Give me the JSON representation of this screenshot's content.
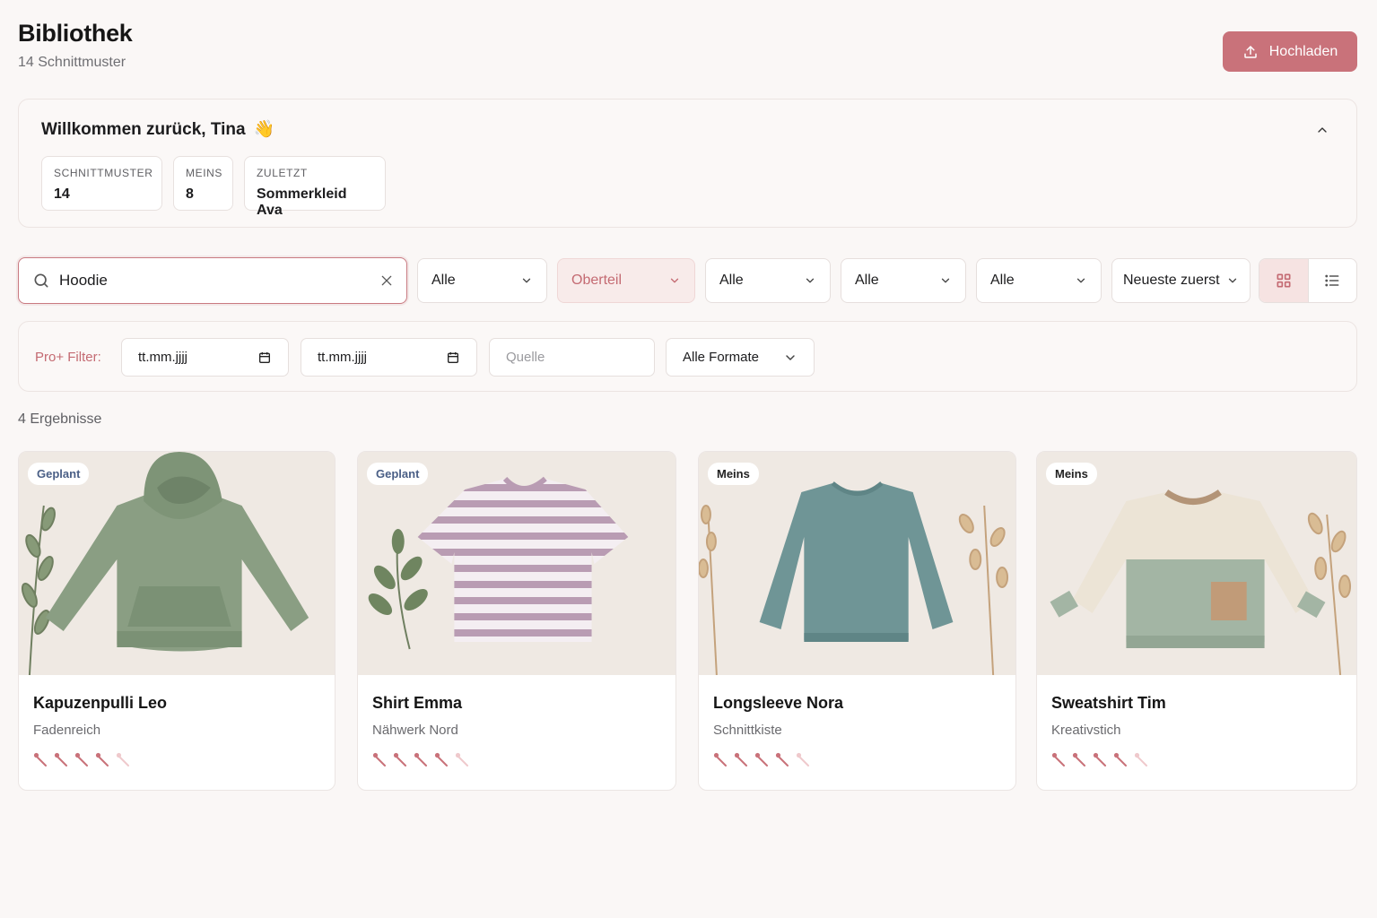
{
  "header": {
    "title": "Bibliothek",
    "subtitle": "14 Schnittmuster",
    "upload_label": "Hochladen"
  },
  "welcome": {
    "title": "Willkommen zurück, Tina",
    "emoji": "👋",
    "stats": [
      {
        "label": "Schnittmuster",
        "value": "14"
      },
      {
        "label": "Meins",
        "value": "8"
      },
      {
        "label": "Zuletzt",
        "value": "Sommerkleid Ava"
      }
    ]
  },
  "filters": {
    "search_value": "Hoodie",
    "selects": [
      "Alle",
      "Oberteil",
      "Alle",
      "Alle",
      "Alle",
      "Neueste zuerst"
    ],
    "active_select_index": 1
  },
  "pro_filter": {
    "label": "Pro+ Filter:",
    "date_from": "tt.mm.jjjj",
    "date_to": "tt.mm.jjjj",
    "source_placeholder": "Quelle",
    "format": "Alle Formate"
  },
  "results_label": "4 Ergebnisse",
  "cards": [
    {
      "badge": "Geplant",
      "title": "Kapuzenpulli Leo",
      "brand": "Fadenreich",
      "rating": 4,
      "max_rating": 5,
      "garment": "hoodie",
      "color": "#8a9e83"
    },
    {
      "badge": "Geplant",
      "title": "Shirt Emma",
      "brand": "Nähwerk Nord",
      "rating": 4,
      "max_rating": 5,
      "garment": "striped-tshirt",
      "color": "#b99cb3"
    },
    {
      "badge": "Meins",
      "title": "Longsleeve Nora",
      "brand": "Schnittkiste",
      "rating": 4,
      "max_rating": 5,
      "garment": "longsleeve",
      "color": "#6f9596"
    },
    {
      "badge": "Meins",
      "title": "Sweatshirt Tim",
      "brand": "Kreativstich",
      "rating": 4,
      "max_rating": 5,
      "garment": "colorblock-sweatshirt",
      "color": "#a3b5a4"
    }
  ],
  "colors": {
    "accent": "#c9727a",
    "accent_text": "#c46a72",
    "background": "#faf7f6"
  }
}
